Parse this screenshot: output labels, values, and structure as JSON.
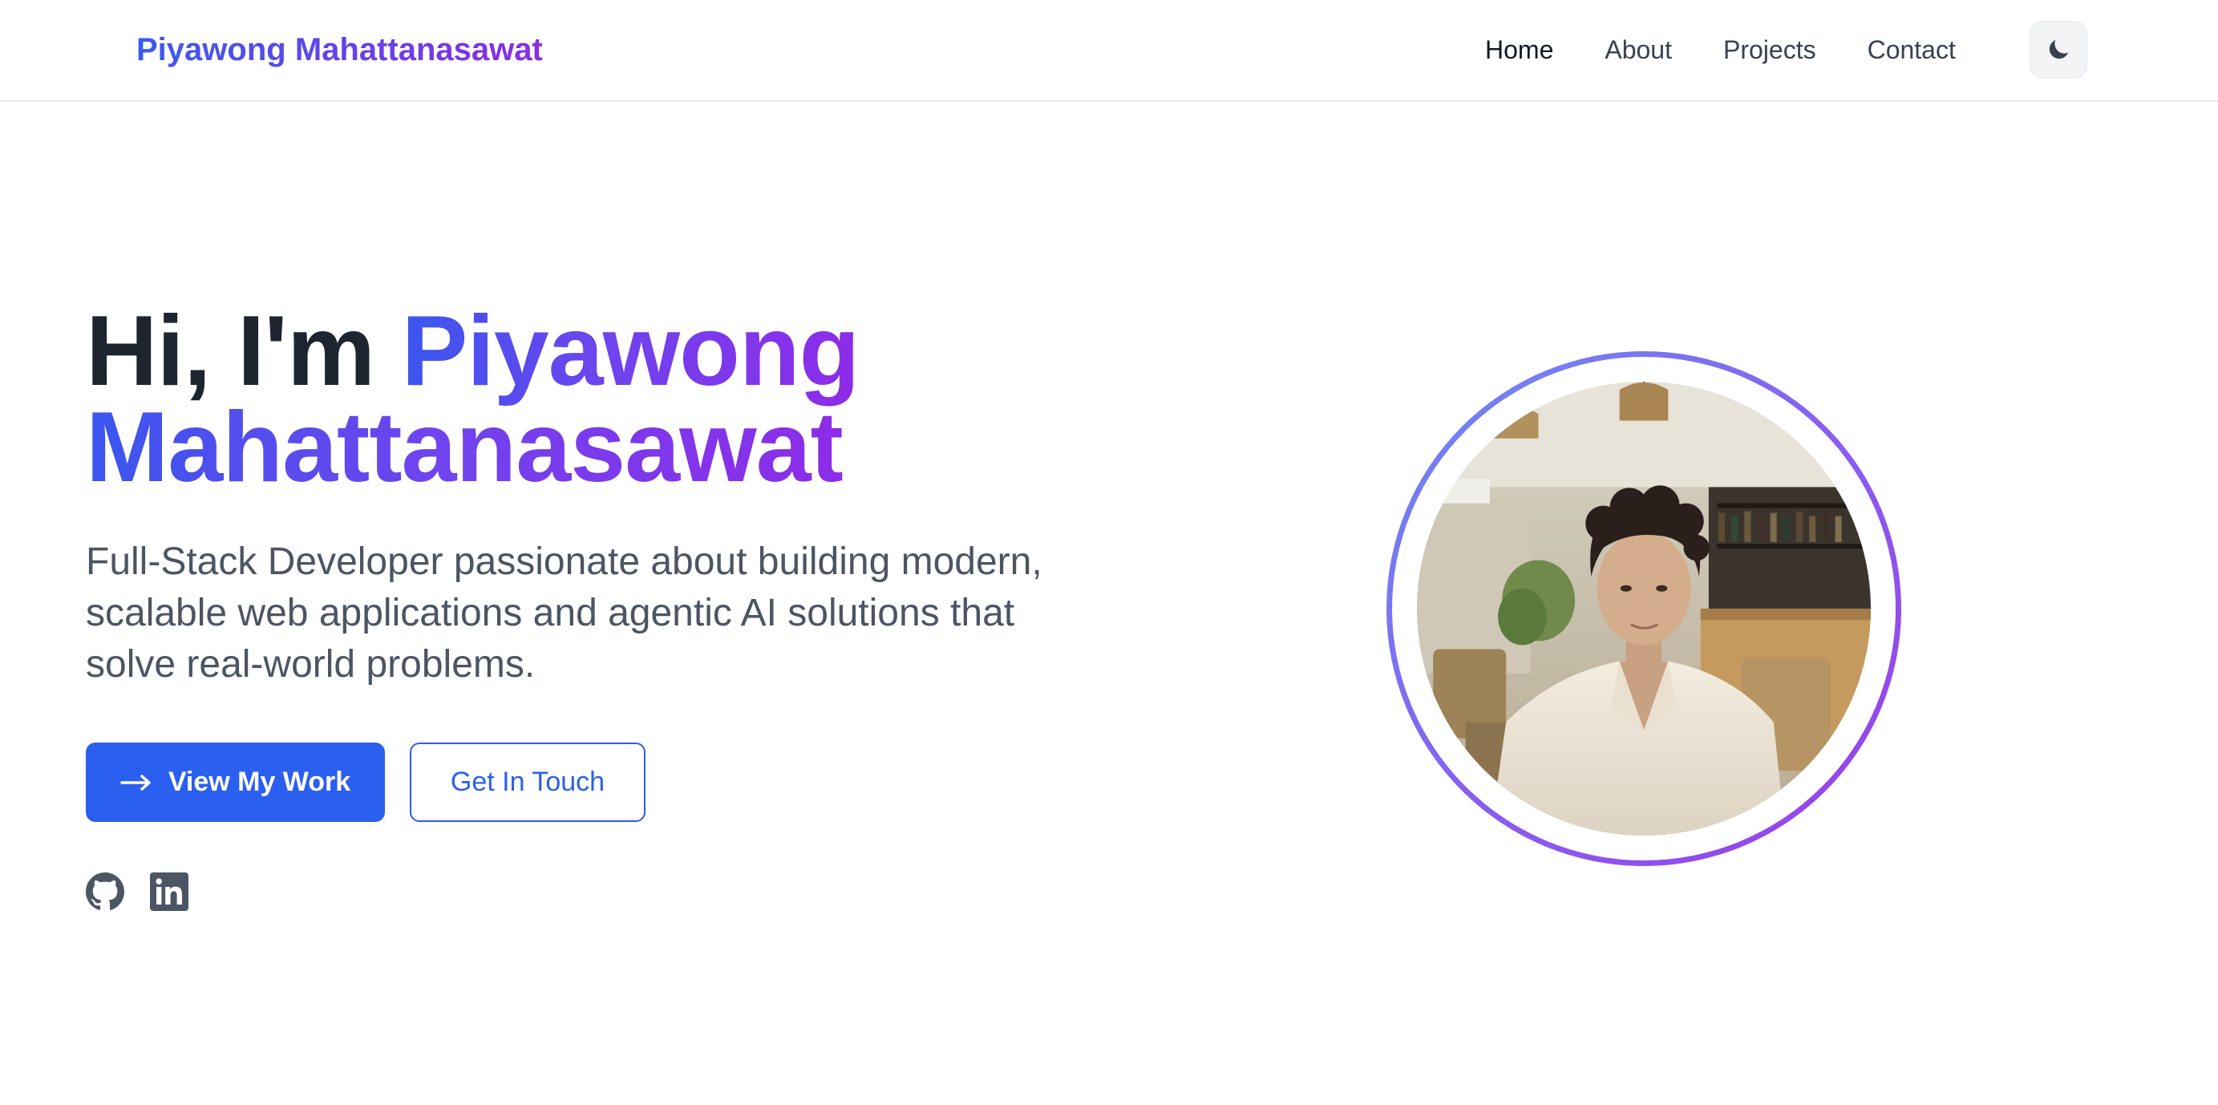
{
  "header": {
    "brand": "Piyawong Mahattanasawat",
    "nav": [
      {
        "label": "Home"
      },
      {
        "label": "About"
      },
      {
        "label": "Projects"
      },
      {
        "label": "Contact"
      }
    ],
    "theme_toggle_icon": "moon-icon"
  },
  "hero": {
    "greeting": "Hi, I'm",
    "first_name": "Piyawong",
    "last_name": "Mahattanasawat",
    "subtitle": "Full-Stack Developer passionate about building modern, scalable web applications and agentic AI solutions that solve real-world problems.",
    "primary_button": {
      "label": "View My Work",
      "icon": "arrow-right-icon"
    },
    "secondary_button": {
      "label": "Get In Touch"
    },
    "social_icons": [
      "github-icon",
      "linkedin-icon"
    ]
  },
  "colors": {
    "accent_blue": "#2b5ff0",
    "gradient_start": "#3b5bf0",
    "gradient_end": "#8b2be6",
    "heading": "#1e2530",
    "body_text": "#4b5563"
  }
}
